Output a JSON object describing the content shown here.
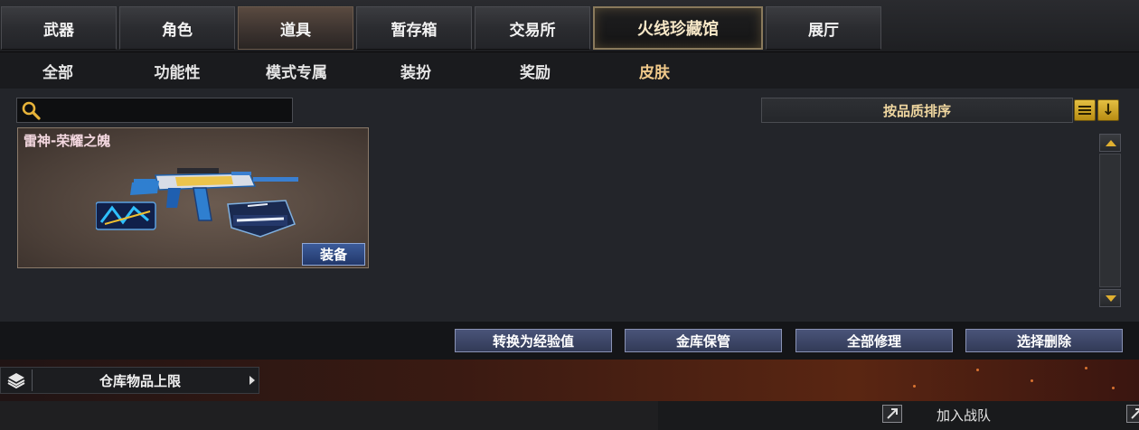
{
  "top_tabs": [
    {
      "label": "武器"
    },
    {
      "label": "角色"
    },
    {
      "label": "道具",
      "selected": true
    },
    {
      "label": "暂存箱"
    },
    {
      "label": "交易所"
    },
    {
      "label": "火线珍藏馆",
      "special": true
    },
    {
      "label": "展厅"
    }
  ],
  "sub_tabs": [
    {
      "label": "全部"
    },
    {
      "label": "功能性"
    },
    {
      "label": "模式专属"
    },
    {
      "label": "装扮"
    },
    {
      "label": "奖励"
    },
    {
      "label": "皮肤",
      "selected": true
    }
  ],
  "search": {
    "value": "",
    "icon": "magnifier-icon"
  },
  "sort": {
    "label": "按品质排序",
    "list_icon": "list-icon",
    "direction_icon": "↓"
  },
  "items": [
    {
      "name": "雷神-荣耀之魄",
      "equip_label": "装备"
    }
  ],
  "actions": {
    "convert_exp": "转换为经验值",
    "vault_store": "金库保管",
    "repair_all": "全部修理",
    "select_delete": "选择删除"
  },
  "storage": {
    "label": "仓库物品上限",
    "icon": "layers-icon"
  },
  "team": {
    "join_label": "加入战队"
  },
  "colors": {
    "accent_gold": "#f0c98a",
    "button_blue": "#3c5b9a",
    "sort_button_gold": "#e4bf42"
  }
}
